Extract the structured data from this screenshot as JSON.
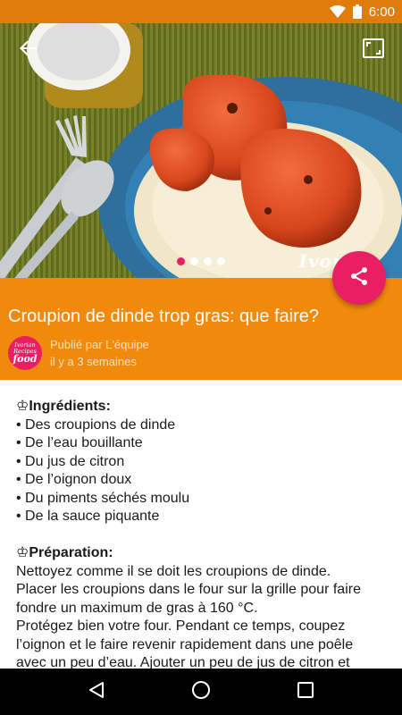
{
  "status_bar": {
    "time": "6:00"
  },
  "hero": {
    "watermark": "Ivori",
    "carousel": {
      "count": 4,
      "active_index": 0
    }
  },
  "article": {
    "title": "Croupion de dinde trop gras: que faire?",
    "author": "Publié par L'équipe",
    "date": "il y a 3 semaines",
    "logo_lines": [
      "Ivorian",
      "Recipes",
      "food"
    ]
  },
  "content": {
    "ingredients_heading": "♔Ingrédients:",
    "ingredients": [
      "• Des croupions de dinde",
      "• De l’eau bouillante",
      "• Du jus de citron",
      "• De l’oignon doux",
      "• Du piments séchés moulu",
      "• De la sauce piquante"
    ],
    "preparation_heading": "♔Préparation:",
    "preparation_lines": [
      "Nettoyez comme il se doit les croupions de dinde.",
      "Placer les croupions dans le four sur la grille pour faire",
      "fondre un maximum de gras à 160 °C.",
      "Protégez bien votre four. Pendant ce temps, coupez",
      "l’oignon et le faire revenir rapidement dans une poêle",
      "avec un peu d’eau. Ajouter un peu de jus de citron et"
    ]
  },
  "colors": {
    "status_bar": "#e07c0c",
    "title_panel": "#f18a0c",
    "accent": "#e91e63",
    "nav_bar": "#000000"
  },
  "icons": {
    "back": "arrow-back-icon",
    "fullscreen": "fullscreen-icon",
    "share": "share-icon",
    "nav_back": "triangle-back-icon",
    "nav_home": "circle-home-icon",
    "nav_recents": "square-recents-icon"
  }
}
